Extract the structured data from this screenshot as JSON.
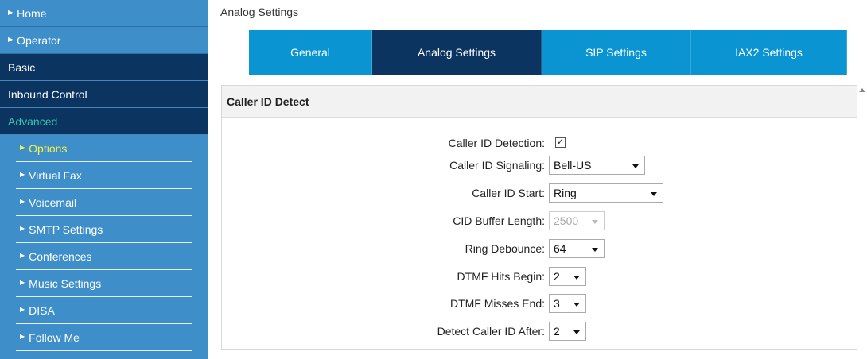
{
  "sidebar": {
    "top_items": [
      {
        "label": "Home"
      },
      {
        "label": "Operator"
      }
    ],
    "sections": [
      {
        "label": "Basic"
      },
      {
        "label": "Inbound Control"
      },
      {
        "label": "Advanced"
      }
    ],
    "advanced_items": [
      {
        "label": "Options"
      },
      {
        "label": "Virtual Fax"
      },
      {
        "label": "Voicemail"
      },
      {
        "label": "SMTP Settings"
      },
      {
        "label": "Conferences"
      },
      {
        "label": "Music Settings"
      },
      {
        "label": "DISA"
      },
      {
        "label": "Follow Me"
      }
    ]
  },
  "main": {
    "title": "Analog Settings",
    "tabs": [
      {
        "label": "General"
      },
      {
        "label": "Analog Settings"
      },
      {
        "label": "SIP Settings"
      },
      {
        "label": "IAX2 Settings"
      }
    ],
    "panel": {
      "title": "Caller ID Detect",
      "fields": {
        "caller_id_detection": {
          "label": "Caller ID Detection:",
          "checked": true,
          "mark": "✓"
        },
        "caller_id_signaling": {
          "label": "Caller ID Signaling:",
          "value": "Bell-US"
        },
        "caller_id_start": {
          "label": "Caller ID Start:",
          "value": "Ring"
        },
        "cid_buffer_length": {
          "label": "CID Buffer Length:",
          "value": "2500",
          "disabled": true
        },
        "ring_debounce": {
          "label": "Ring Debounce:",
          "value": "64"
        },
        "dtmf_hits_begin": {
          "label": "DTMF Hits Begin:",
          "value": "2"
        },
        "dtmf_misses_end": {
          "label": "DTMF Misses End:",
          "value": "3"
        },
        "detect_caller_id_after": {
          "label": "Detect Caller ID After:",
          "value": "2"
        }
      }
    }
  },
  "colors": {
    "sidebar_bg": "#3e8fc9",
    "section_bg": "#0b3460",
    "tab_bg": "#0a94d1",
    "tab_active_bg": "#0b3460",
    "advanced_text": "#33c7b0",
    "active_item_text": "#f5f04a"
  }
}
